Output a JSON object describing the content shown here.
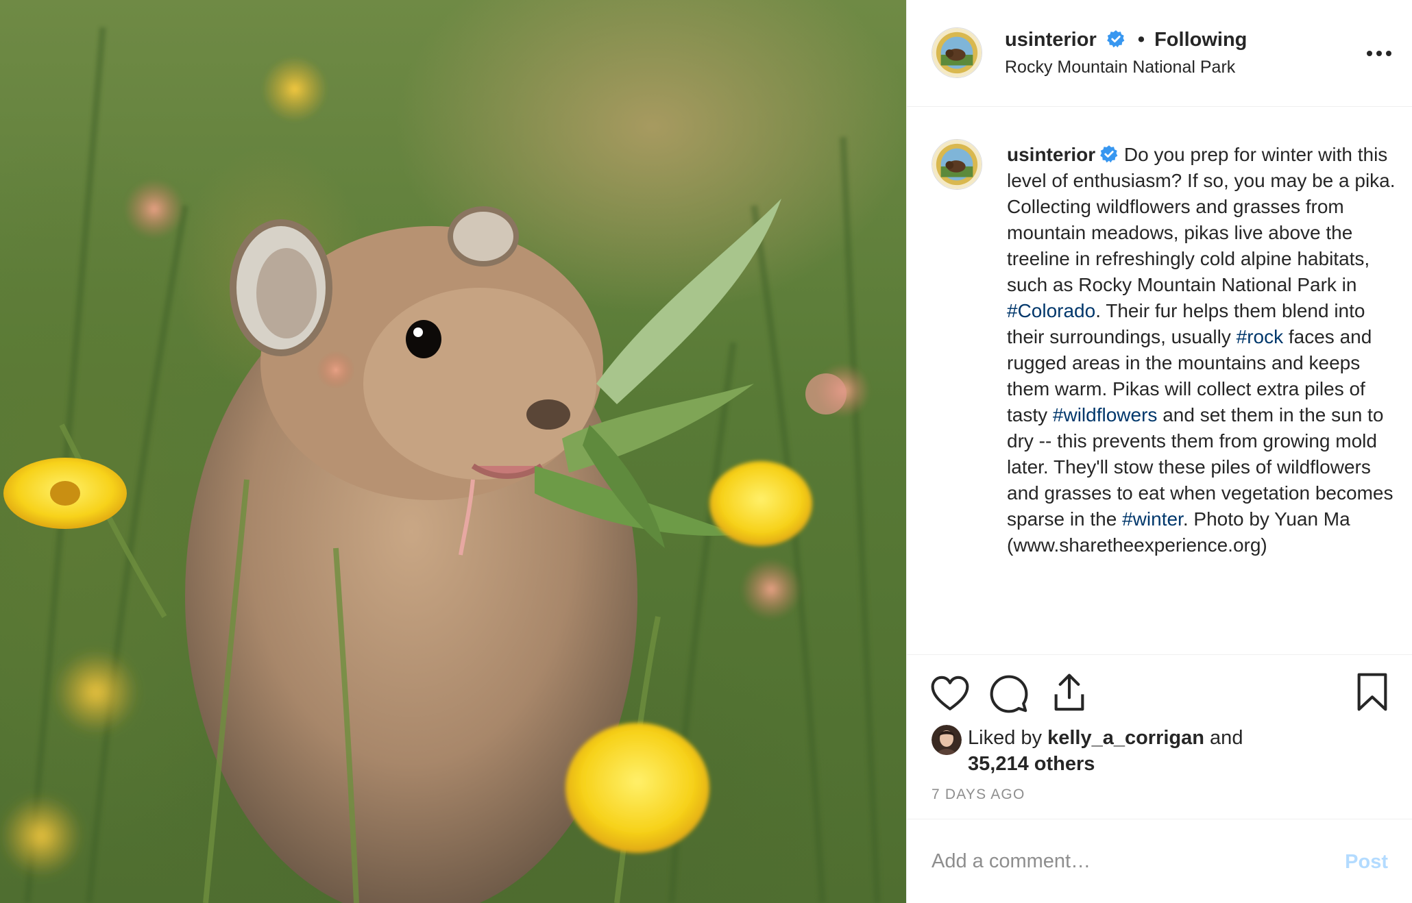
{
  "post": {
    "username": "usinterior",
    "follow_status": "Following",
    "location": "Rocky Mountain National Park",
    "verified_icon": "verified-badge-icon",
    "more_icon": "more-options-icon"
  },
  "caption": {
    "username": "usinterior",
    "part1": "Do you prep for winter with this level of enthusiasm? If so, you may be a pika.",
    "part2": "Collecting wildflowers and grasses from mountain meadows, pikas live above the treeline in refreshingly cold alpine habitats, such as Rocky Mountain National Park in ",
    "tag1": "#Colorado",
    "part3": ". Their fur helps them blend into their surroundings, usually ",
    "tag2": "#rock",
    "part4": " faces and rugged areas in the mountains and keeps them warm. Pikas will collect extra piles of tasty ",
    "tag3": "#wildflowers",
    "part5": " and set them in the sun to dry -- this prevents them from growing mold later. They'll stow these piles of wildflowers and grasses to eat when vegetation becomes sparse in the ",
    "tag4": "#winter",
    "part6": ". Photo by Yuan Ma (www.sharetheexperience.org)"
  },
  "actions": {
    "like_icon": "heart-icon",
    "comment_icon": "comment-icon",
    "share_icon": "share-icon",
    "save_icon": "bookmark-icon"
  },
  "likes": {
    "prefix": "Liked by ",
    "first_liker": "kelly_a_corrigan",
    "conjunction": " and",
    "others": "35,214 others"
  },
  "timestamp": "7 DAYS AGO",
  "comment": {
    "placeholder": "Add a comment…",
    "post_label": "Post"
  },
  "colors": {
    "hashtag": "#00376b",
    "verified": "#3897f0",
    "post_disabled": "#b3dbff",
    "muted": "#8e8e8e"
  }
}
